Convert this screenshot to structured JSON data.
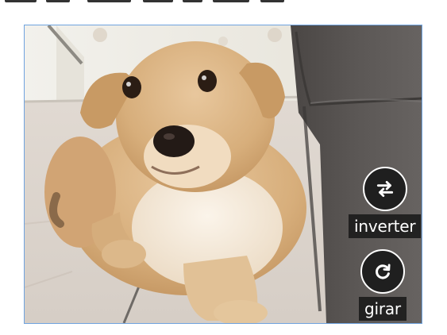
{
  "controls": {
    "invert": {
      "label": "inverter",
      "icon": "swap-arrows-icon"
    },
    "rotate": {
      "label": "girar",
      "icon": "rotate-icon"
    }
  },
  "photo": {
    "subject": "puppy"
  },
  "colors": {
    "frame_border": "#6fa3df",
    "button_bg": "#1f1f1f",
    "label_bg": "#191919",
    "label_text": "#ffffff"
  }
}
